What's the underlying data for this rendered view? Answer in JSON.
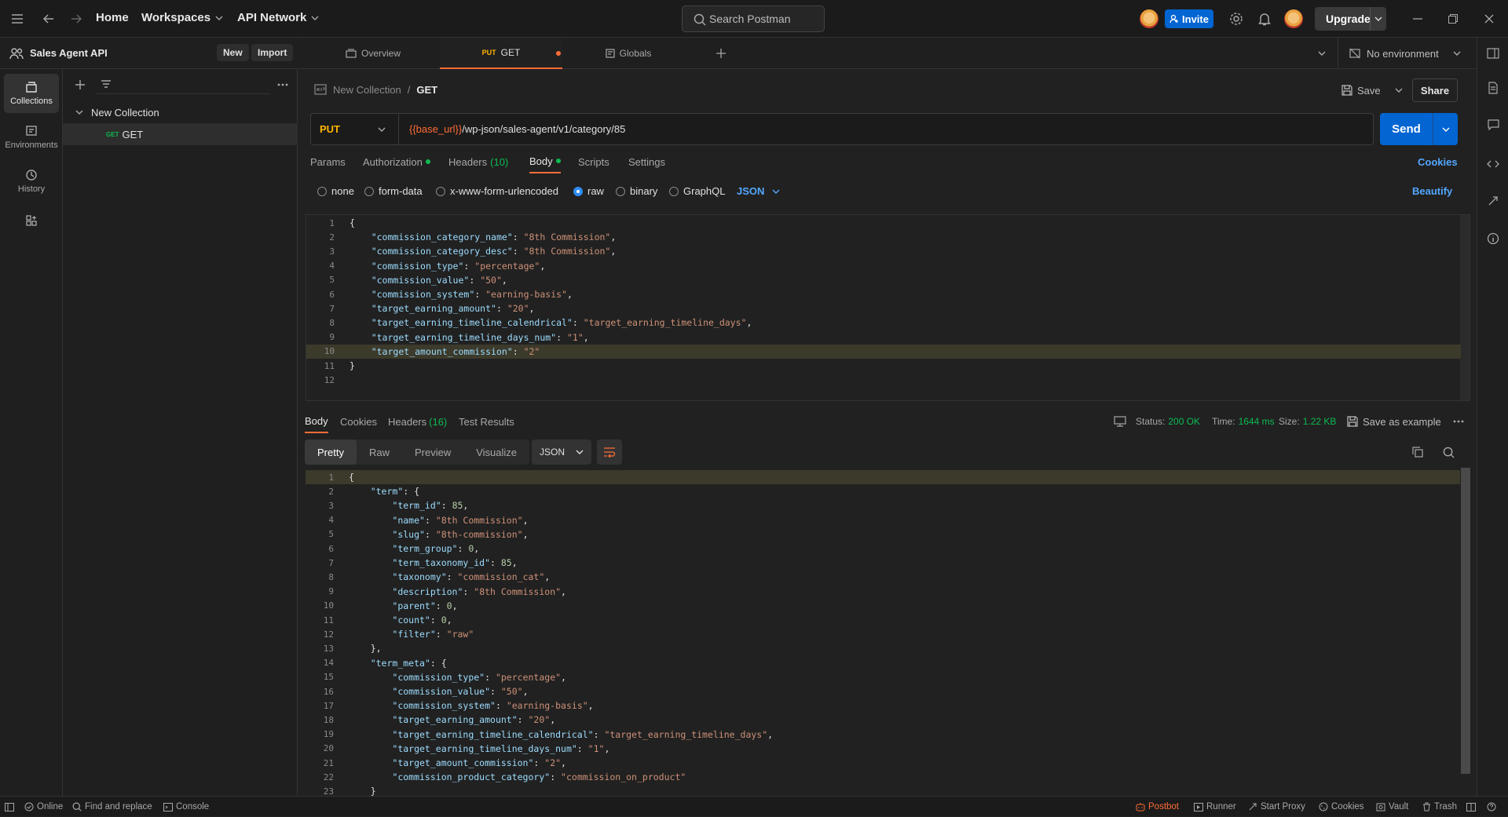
{
  "topbar": {
    "home": "Home",
    "workspaces": "Workspaces",
    "api_network": "API Network",
    "search_placeholder": "Search Postman",
    "invite": "Invite",
    "upgrade": "Upgrade"
  },
  "workspace": {
    "name": "Sales Agent API",
    "new_label": "New",
    "import_label": "Import"
  },
  "rail": {
    "collections": "Collections",
    "environments": "Environments",
    "history": "History"
  },
  "tree": {
    "collection": "New Collection",
    "request_method": "GET",
    "request_name": "GET"
  },
  "tabs": {
    "overview": "Overview",
    "active_method": "PUT",
    "active_name": "GET",
    "globals": "Globals",
    "environment": "No environment"
  },
  "breadcrumb": {
    "collection": "New Collection",
    "separator": "/",
    "request": "GET",
    "save": "Save",
    "share": "Share"
  },
  "request": {
    "method": "PUT",
    "url_var": "{{base_url}}",
    "url_path": "/wp-json/sales-agent/v1/category/85",
    "send": "Send"
  },
  "req_tabs": {
    "params": "Params",
    "authorization": "Authorization",
    "headers": "Headers",
    "headers_count": "(10)",
    "body": "Body",
    "scripts": "Scripts",
    "settings": "Settings",
    "cookies": "Cookies"
  },
  "body_types": {
    "none": "none",
    "form_data": "form-data",
    "urlencoded": "x-www-form-urlencoded",
    "raw": "raw",
    "binary": "binary",
    "graphql": "GraphQL",
    "format": "JSON",
    "beautify": "Beautify"
  },
  "request_body": [
    {
      "n": "1",
      "text": "{"
    },
    {
      "n": "2",
      "key": "\"commission_category_name\"",
      "val": "\"8th Commission\"",
      "tail": ","
    },
    {
      "n": "3",
      "key": "\"commission_category_desc\"",
      "val": "\"8th Commission\"",
      "tail": ","
    },
    {
      "n": "4",
      "key": "\"commission_type\"",
      "val": "\"percentage\"",
      "tail": ","
    },
    {
      "n": "5",
      "key": "\"commission_value\"",
      "val": "\"50\"",
      "tail": ","
    },
    {
      "n": "6",
      "key": "\"commission_system\"",
      "val": "\"earning-basis\"",
      "tail": ","
    },
    {
      "n": "7",
      "key": "\"target_earning_amount\"",
      "val": "\"20\"",
      "tail": ","
    },
    {
      "n": "8",
      "key": "\"target_earning_timeline_calendrical\"",
      "val": "\"target_earning_timeline_days\"",
      "tail": ","
    },
    {
      "n": "9",
      "key": "\"target_earning_timeline_days_num\"",
      "val": "\"1\"",
      "tail": ","
    },
    {
      "n": "10",
      "key": "\"target_amount_commission\"",
      "val": "\"2\"",
      "tail": ""
    },
    {
      "n": "11",
      "text": "}"
    },
    {
      "n": "12",
      "text": ""
    }
  ],
  "response": {
    "body": "Body",
    "cookies": "Cookies",
    "headers": "Headers",
    "headers_count": "(16)",
    "test_results": "Test Results",
    "status_label": "Status:",
    "status": "200 OK",
    "time_label": "Time:",
    "time": "1644 ms",
    "size_label": "Size:",
    "size": "1.22 KB",
    "save_example": "Save as example",
    "views": [
      "Pretty",
      "Raw",
      "Preview",
      "Visualize"
    ],
    "format": "JSON"
  },
  "response_body": [
    {
      "n": "1",
      "text": "{"
    },
    {
      "n": "2",
      "indent": 1,
      "key": "\"term\"",
      "rest": ": {"
    },
    {
      "n": "3",
      "indent": 2,
      "key": "\"term_id\"",
      "rest": ": ",
      "num": "85",
      "tail": ","
    },
    {
      "n": "4",
      "indent": 2,
      "key": "\"name\"",
      "rest": ": ",
      "val": "\"8th Commission\"",
      "tail": ","
    },
    {
      "n": "5",
      "indent": 2,
      "key": "\"slug\"",
      "rest": ": ",
      "val": "\"8th-commission\"",
      "tail": ","
    },
    {
      "n": "6",
      "indent": 2,
      "key": "\"term_group\"",
      "rest": ": ",
      "num": "0",
      "tail": ","
    },
    {
      "n": "7",
      "indent": 2,
      "key": "\"term_taxonomy_id\"",
      "rest": ": ",
      "num": "85",
      "tail": ","
    },
    {
      "n": "8",
      "indent": 2,
      "key": "\"taxonomy\"",
      "rest": ": ",
      "val": "\"commission_cat\"",
      "tail": ","
    },
    {
      "n": "9",
      "indent": 2,
      "key": "\"description\"",
      "rest": ": ",
      "val": "\"8th Commission\"",
      "tail": ","
    },
    {
      "n": "10",
      "indent": 2,
      "key": "\"parent\"",
      "rest": ": ",
      "num": "0",
      "tail": ","
    },
    {
      "n": "11",
      "indent": 2,
      "key": "\"count\"",
      "rest": ": ",
      "num": "0",
      "tail": ","
    },
    {
      "n": "12",
      "indent": 2,
      "key": "\"filter\"",
      "rest": ": ",
      "val": "\"raw\"",
      "tail": ""
    },
    {
      "n": "13",
      "indent": 1,
      "text": "},"
    },
    {
      "n": "14",
      "indent": 1,
      "key": "\"term_meta\"",
      "rest": ": {"
    },
    {
      "n": "15",
      "indent": 2,
      "key": "\"commission_type\"",
      "rest": ": ",
      "val": "\"percentage\"",
      "tail": ","
    },
    {
      "n": "16",
      "indent": 2,
      "key": "\"commission_value\"",
      "rest": ": ",
      "val": "\"50\"",
      "tail": ","
    },
    {
      "n": "17",
      "indent": 2,
      "key": "\"commission_system\"",
      "rest": ": ",
      "val": "\"earning-basis\"",
      "tail": ","
    },
    {
      "n": "18",
      "indent": 2,
      "key": "\"target_earning_amount\"",
      "rest": ": ",
      "val": "\"20\"",
      "tail": ","
    },
    {
      "n": "19",
      "indent": 2,
      "key": "\"target_earning_timeline_calendrical\"",
      "rest": ": ",
      "val": "\"target_earning_timeline_days\"",
      "tail": ","
    },
    {
      "n": "20",
      "indent": 2,
      "key": "\"target_earning_timeline_days_num\"",
      "rest": ": ",
      "val": "\"1\"",
      "tail": ","
    },
    {
      "n": "21",
      "indent": 2,
      "key": "\"target_amount_commission\"",
      "rest": ": ",
      "val": "\"2\"",
      "tail": ","
    },
    {
      "n": "22",
      "indent": 2,
      "key": "\"commission_product_category\"",
      "rest": ": ",
      "val": "\"commission_on_product\"",
      "tail": ""
    },
    {
      "n": "23",
      "indent": 1,
      "text": "}"
    }
  ],
  "statusbar": {
    "online": "Online",
    "find_replace": "Find and replace",
    "console": "Console",
    "postbot": "Postbot",
    "runner": "Runner",
    "start_proxy": "Start Proxy",
    "cookies": "Cookies",
    "vault": "Vault",
    "trash": "Trash"
  },
  "colors": {
    "accent": "#ff6c37",
    "primary": "#0265d2",
    "success": "#0cbb52",
    "method_put": "#ffb400"
  }
}
